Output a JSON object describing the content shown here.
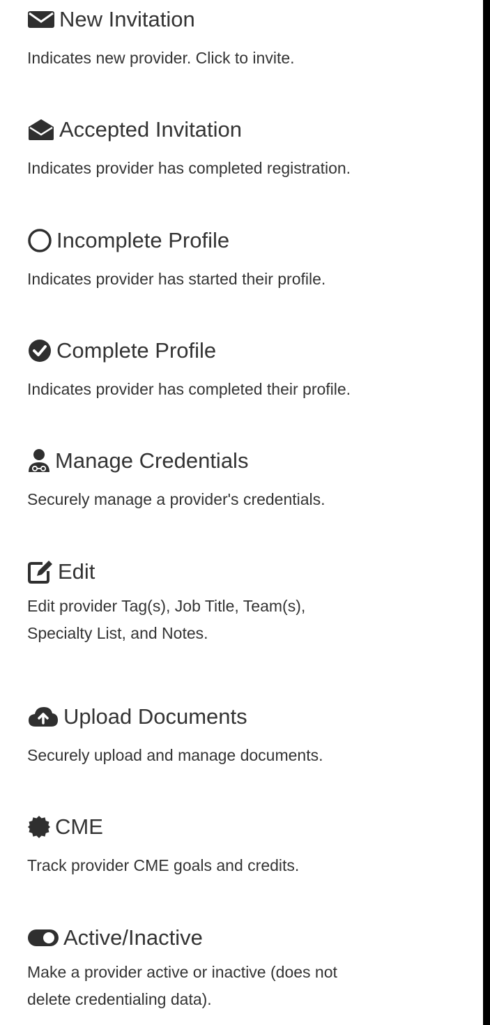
{
  "legend": {
    "items": [
      {
        "icon": "envelope-icon",
        "title": "New Invitation",
        "description": "Indicates new provider. Click to invite."
      },
      {
        "icon": "envelope-open-icon",
        "title": "Accepted Invitation",
        "description": "Indicates provider has completed registration."
      },
      {
        "icon": "circle-outline-icon",
        "title": "Incomplete Profile",
        "description": "Indicates provider has started their profile."
      },
      {
        "icon": "check-circle-icon",
        "title": "Complete Profile",
        "description": "Indicates provider has completed their profile."
      },
      {
        "icon": "user-credentials-icon",
        "title": "Manage Credentials",
        "description": "Securely manage a provider's credentials."
      },
      {
        "icon": "edit-icon",
        "title": "Edit",
        "description_lines": [
          "Edit provider Tag(s), Job Title, Team(s),",
          "Specialty List, and Notes."
        ]
      },
      {
        "icon": "cloud-upload-icon",
        "title": "Upload Documents",
        "description": "Securely upload and manage documents."
      },
      {
        "icon": "certificate-icon",
        "title": "CME",
        "description": "Track provider CME goals and credits."
      },
      {
        "icon": "toggle-icon",
        "title": "Active/Inactive",
        "description_lines": [
          "Make a provider active or inactive (does not",
          "delete credentialing data)."
        ]
      }
    ]
  }
}
